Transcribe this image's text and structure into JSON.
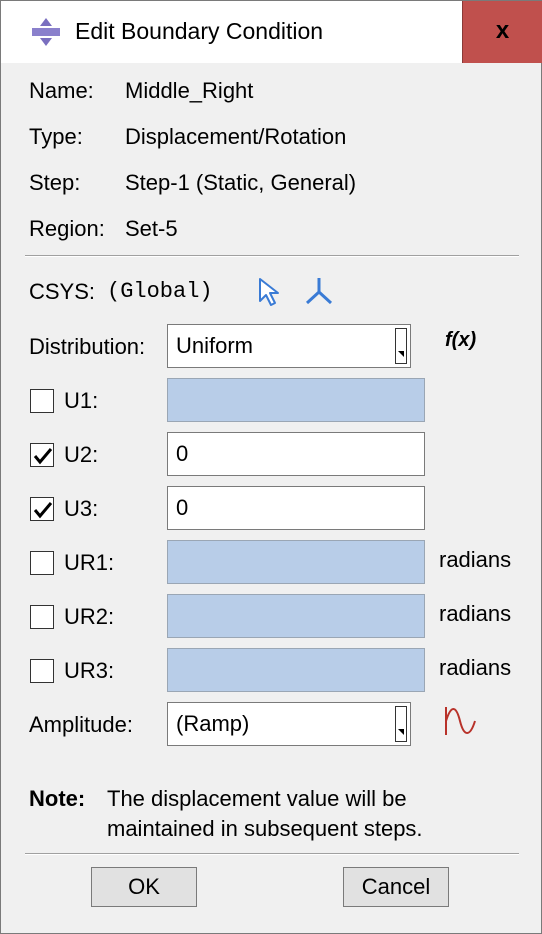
{
  "window": {
    "title": "Edit Boundary Condition",
    "close_label": "x"
  },
  "info": [
    {
      "label": "Name:",
      "value": "Middle_Right"
    },
    {
      "label": "Type:",
      "value": "Displacement/Rotation"
    },
    {
      "label": "Step:",
      "value": "Step-1 (Static, General)"
    },
    {
      "label": "Region:",
      "value": "Set-5"
    }
  ],
  "csys": {
    "label": "CSYS:",
    "value": "(Global)",
    "icons": [
      "select-arrow-icon",
      "csys-axes-icon"
    ]
  },
  "distribution": {
    "label": "Distribution:",
    "value": "Uniform",
    "function_label": "f(x)"
  },
  "dofs": [
    {
      "label": "U1:",
      "checked": false,
      "value": "",
      "unit": ""
    },
    {
      "label": "U2:",
      "checked": true,
      "value": "0",
      "unit": ""
    },
    {
      "label": "U3:",
      "checked": true,
      "value": "0",
      "unit": ""
    },
    {
      "label": "UR1:",
      "checked": false,
      "value": "",
      "unit": "radians"
    },
    {
      "label": "UR2:",
      "checked": false,
      "value": "",
      "unit": "radians"
    },
    {
      "label": "UR3:",
      "checked": false,
      "value": "",
      "unit": "radians"
    }
  ],
  "amplitude": {
    "label": "Amplitude:",
    "value": "(Ramp)",
    "icon": "amplitude-wave-icon"
  },
  "note": {
    "label": "Note:",
    "line1": "The displacement value will be",
    "line2": "maintained in subsequent steps."
  },
  "buttons": {
    "ok": "OK",
    "cancel": "Cancel"
  },
  "colors": {
    "close_bg": "#c0504d",
    "disabled_field": "#b8cde8",
    "icon_blue": "#3a7bd5",
    "amplitude_red": "#b8322a"
  }
}
